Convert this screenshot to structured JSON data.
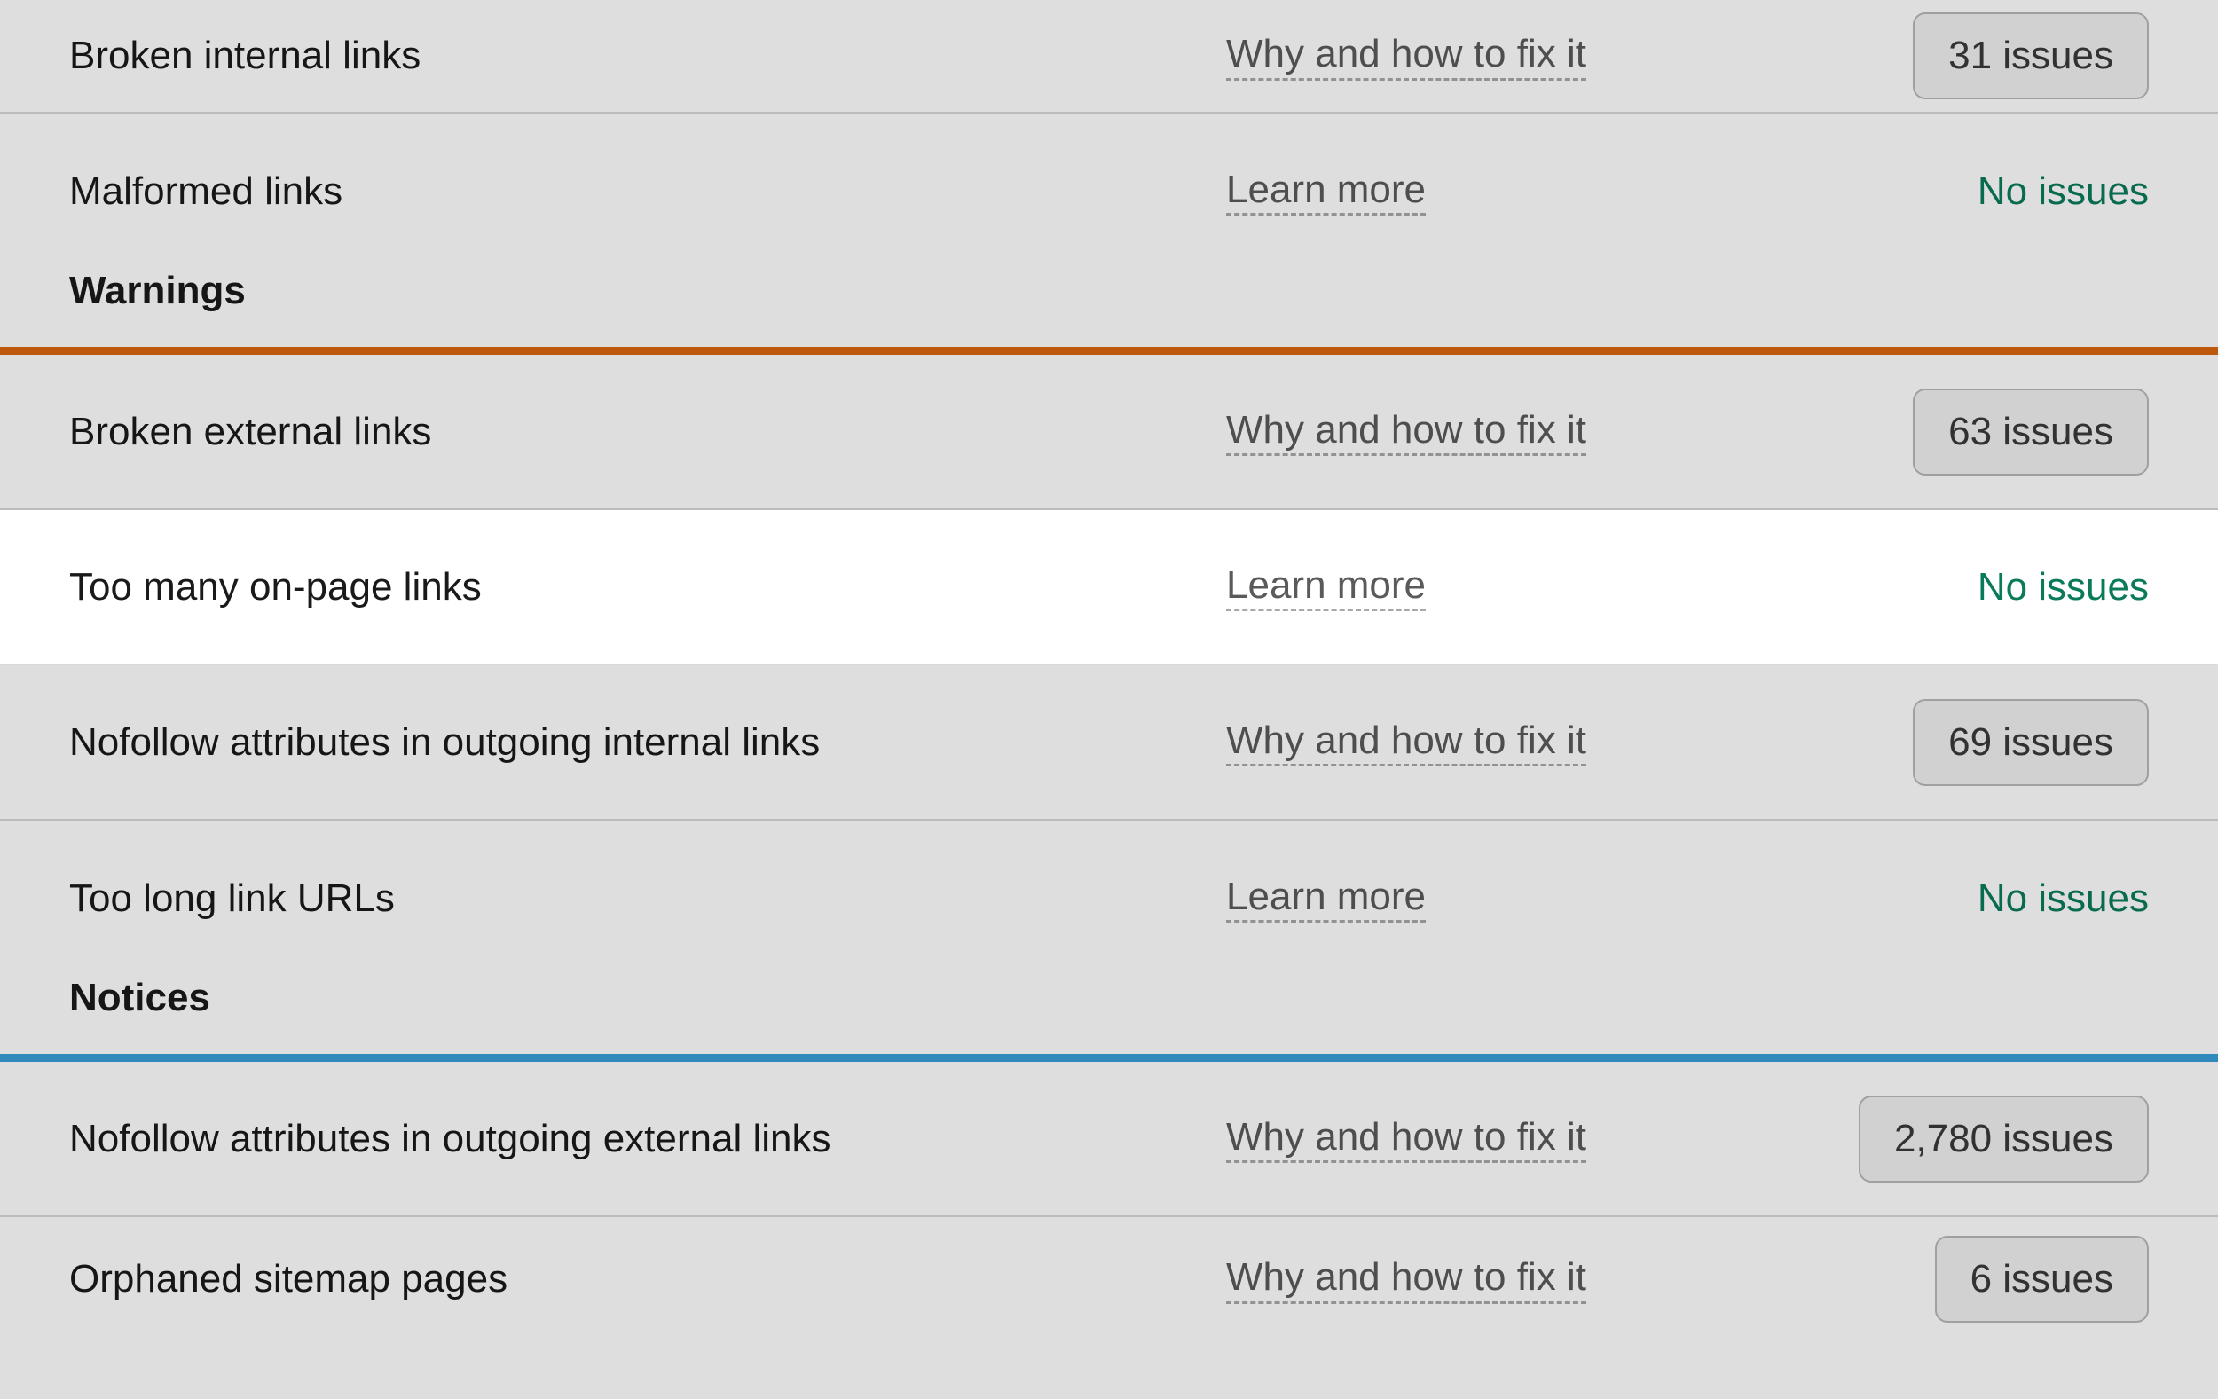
{
  "sections": {
    "warnings_header": "Warnings",
    "notices_header": "Notices"
  },
  "labels": {
    "learn_more": "Learn more",
    "why_fix": "Why and how to fix it",
    "no_issues": "No issues"
  },
  "rows": {
    "broken_internal": {
      "label": "Broken internal links",
      "link": "Why and how to fix it",
      "issues": "31 issues"
    },
    "malformed": {
      "label": "Malformed links",
      "link": "Learn more",
      "issues": null
    },
    "broken_external": {
      "label": "Broken external links",
      "link": "Why and how to fix it",
      "issues": "63 issues"
    },
    "too_many_onpage": {
      "label": "Too many on-page links",
      "link": "Learn more",
      "issues": null
    },
    "nofollow_internal": {
      "label": "Nofollow attributes in outgoing internal links",
      "link": "Why and how to fix it",
      "issues": "69 issues"
    },
    "too_long_urls": {
      "label": "Too long link URLs",
      "link": "Learn more",
      "issues": null
    },
    "nofollow_external": {
      "label": "Nofollow attributes in outgoing external links",
      "link": "Why and how to fix it",
      "issues": "2,780 issues"
    },
    "orphaned_sitemap": {
      "label": "Orphaned sitemap pages",
      "link": "Why and how to fix it",
      "issues": "6 issues"
    }
  }
}
